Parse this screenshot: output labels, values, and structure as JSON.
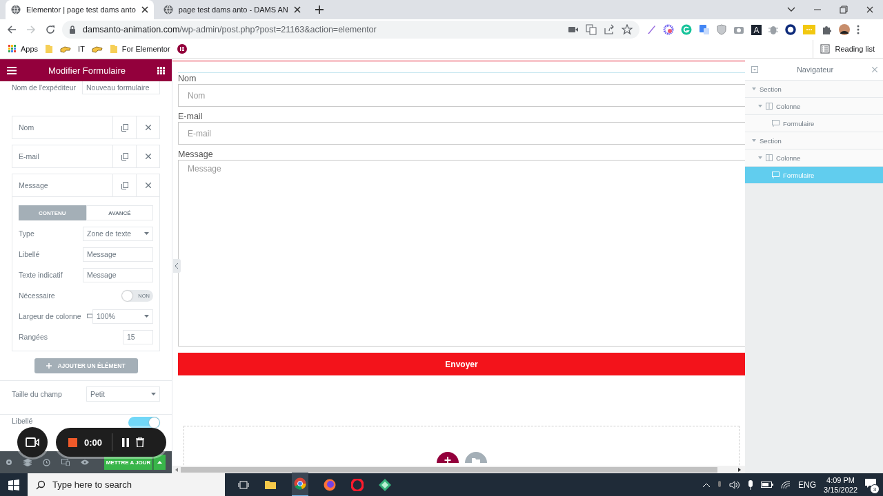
{
  "browser": {
    "tabs": [
      {
        "title": "Elementor | page test dams anto",
        "selected": true
      },
      {
        "title": "page test dams anto - DAMS AN",
        "selected": false
      }
    ],
    "url_host": "damsanto-animation.com",
    "url_path": "/wp-admin/post.php?post=21163&action=elementor",
    "bookmarks": [
      {
        "kind": "apps",
        "label": "Apps"
      },
      {
        "kind": "folder"
      },
      {
        "kind": "hand"
      },
      {
        "kind": "text",
        "label": "IT"
      },
      {
        "kind": "hand"
      },
      {
        "kind": "folder",
        "label": "For Elementor"
      },
      {
        "kind": "elementor"
      }
    ],
    "reading_list": "Reading list"
  },
  "editor_panel": {
    "title": "Modifier Formulaire",
    "sender_label": "Nom de l'expéditeur",
    "sender_value": "Nouveau formulaire",
    "fields": [
      {
        "label": "Nom",
        "expanded": false
      },
      {
        "label": "E-mail",
        "expanded": false
      },
      {
        "label": "Message",
        "expanded": true
      }
    ],
    "field_tabs": [
      {
        "label": "CONTENU",
        "selected": true
      },
      {
        "label": "AVANCÉ",
        "selected": false
      }
    ],
    "field_settings": [
      {
        "kind": "select",
        "label": "Type",
        "value": "Zone de texte"
      },
      {
        "kind": "input",
        "label": "Libellé",
        "value": "Message"
      },
      {
        "kind": "input",
        "label": "Texte indicatif",
        "value": "Message"
      },
      {
        "kind": "toggle",
        "label": "Nécessaire",
        "on": false,
        "text": "NON"
      },
      {
        "kind": "select",
        "label": "Largeur de colonne",
        "value": "100%",
        "device_icon": true
      },
      {
        "kind": "number",
        "label": "Rangées",
        "value": "15"
      }
    ],
    "add_button": "AJOUTER UN ÉLÉMENT",
    "size_label": "Taille du champ",
    "size_value": "Petit",
    "label_toggle": {
      "label": "Libellé",
      "on": true
    },
    "update_button": "METTRE A JOUR"
  },
  "canvas": {
    "form_fields": [
      {
        "kind": "input",
        "label": "Nom",
        "placeholder": "Nom"
      },
      {
        "kind": "input",
        "label": "E-mail",
        "placeholder": "E-mail"
      },
      {
        "kind": "textarea",
        "label": "Message",
        "placeholder": "Message"
      }
    ],
    "submit": "Envoyer"
  },
  "navigator": {
    "title": "Navigateur",
    "tree": [
      {
        "label": "Section",
        "expanded": true,
        "selected": false,
        "children": [
          {
            "label": "Colonne",
            "expanded": true,
            "selected": false,
            "children": [
              {
                "label": "Formulaire",
                "selected": false
              }
            ]
          }
        ]
      },
      {
        "label": "Section",
        "expanded": true,
        "selected": false,
        "children": [
          {
            "label": "Colonne",
            "expanded": true,
            "selected": false,
            "children": [
              {
                "label": "Formulaire",
                "selected": true
              }
            ]
          }
        ]
      }
    ]
  },
  "recorder": {
    "time": "0:00"
  },
  "taskbar": {
    "search_placeholder": "Type here to search",
    "language": "ENG",
    "time": "4:09 PM",
    "date": "3/15/2022",
    "notifications": "3"
  }
}
